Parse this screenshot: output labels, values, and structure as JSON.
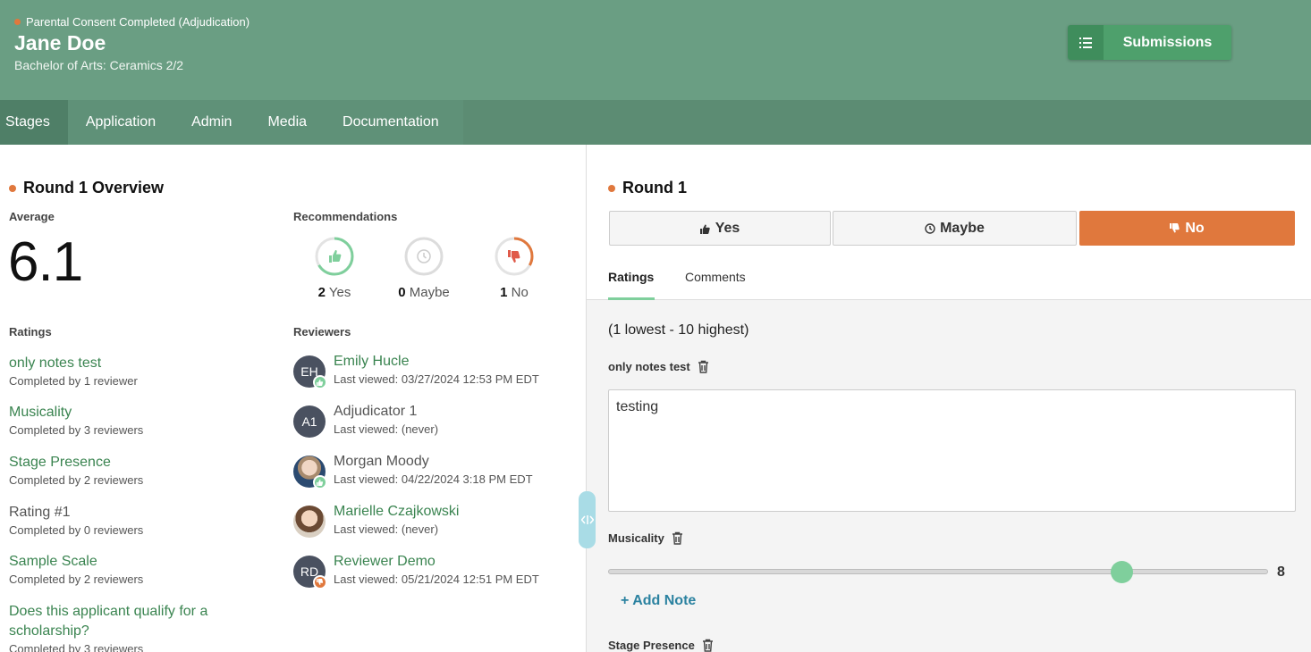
{
  "header": {
    "status": "Parental Consent Completed (Adjudication)",
    "name": "Jane Doe",
    "program": "Bachelor of Arts: Ceramics 2/2",
    "submissions_label": "Submissions"
  },
  "nav": {
    "tabs": [
      "Stages",
      "Application",
      "Admin",
      "Media",
      "Documentation"
    ],
    "active": "Stages"
  },
  "overview": {
    "title": "Round 1 Overview",
    "average_label": "Average",
    "average_value": "6.1",
    "recommendations_label": "Recommendations",
    "recommendations": [
      {
        "count": "2",
        "label": "Yes",
        "fraction": 0.6667,
        "color": "#7fcf9c"
      },
      {
        "count": "0",
        "label": "Maybe",
        "fraction": 0,
        "color": "#cccccc"
      },
      {
        "count": "1",
        "label": "No",
        "fraction": 0.3333,
        "color": "#e0783d"
      }
    ],
    "ratings_label": "Ratings",
    "ratings": [
      {
        "name": "only notes test",
        "sub": "Completed by 1 reviewer"
      },
      {
        "name": "Musicality",
        "sub": "Completed by 3 reviewers"
      },
      {
        "name": "Stage Presence",
        "sub": "Completed by 2 reviewers"
      },
      {
        "name": "Rating #1",
        "sub": "Completed by 0 reviewers"
      },
      {
        "name": "Sample Scale",
        "sub": "Completed by 2 reviewers"
      },
      {
        "name": "Does this applicant qualify for a scholarship?",
        "sub": "Completed by 3 reviewers"
      }
    ],
    "reviewers_label": "Reviewers",
    "reviewers": [
      {
        "initials": "EH",
        "name": "Emily Hucle",
        "last_viewed": "Last viewed: 03/27/2024 12:53 PM EDT",
        "vote": "yes"
      },
      {
        "initials": "A1",
        "name": "Adjudicator 1",
        "last_viewed": "Last viewed: (never)",
        "vote": ""
      },
      {
        "initials": "",
        "name": "Morgan Moody",
        "last_viewed": "Last viewed: 04/22/2024 3:18 PM EDT",
        "vote": "yes"
      },
      {
        "initials": "",
        "name": "Marielle Czajkowski",
        "last_viewed": "Last viewed: (never)",
        "vote": ""
      },
      {
        "initials": "RD",
        "name": "Reviewer Demo",
        "last_viewed": "Last viewed: 05/21/2024 12:51 PM EDT",
        "vote": "no"
      }
    ]
  },
  "round": {
    "title": "Round 1",
    "votes": {
      "yes": "Yes",
      "maybe": "Maybe",
      "no": "No",
      "selected": "No"
    },
    "tabs": {
      "ratings": "Ratings",
      "comments": "Comments",
      "active": "Ratings"
    },
    "scale_note": "(1 lowest - 10 highest)",
    "fields": {
      "notes_label": "only notes test",
      "notes_value": "testing",
      "musicality_label": "Musicality",
      "musicality_value": 8,
      "musicality_min": 1,
      "musicality_max": 10,
      "add_note": "+ Add Note",
      "stage_presence_label": "Stage Presence"
    }
  },
  "colors": {
    "brand_green": "#6a9e83",
    "accent_orange": "#e0783d",
    "link_green": "#3a8450",
    "slider": "#7fcf9c"
  }
}
